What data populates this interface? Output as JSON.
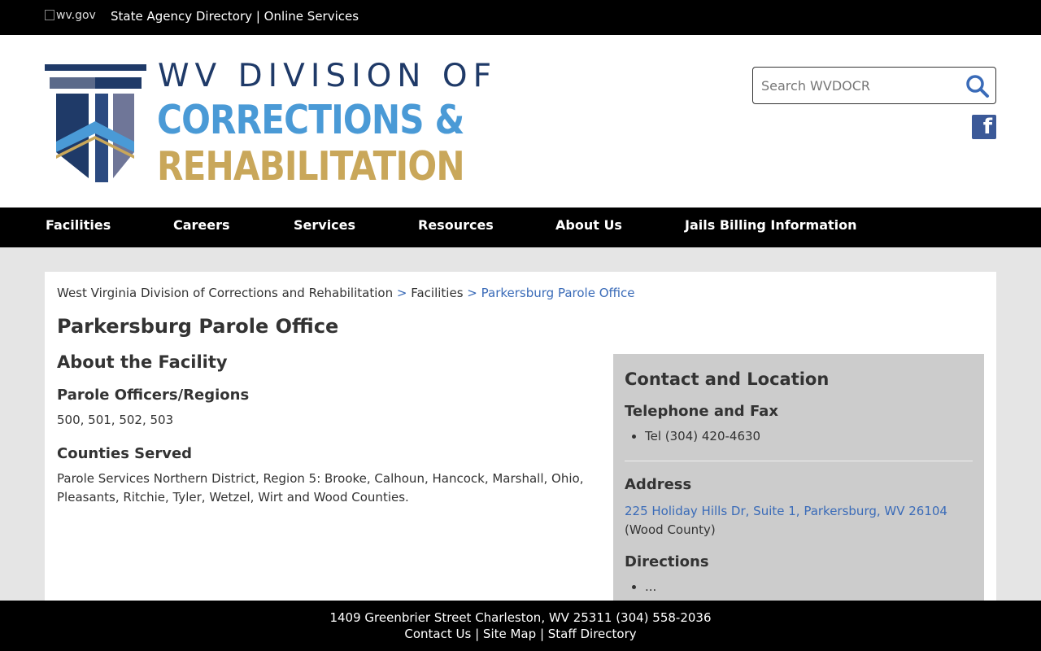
{
  "topbar": {
    "wv_logo_alt": "wv.gov",
    "state_agency_directory": "State Agency Directory",
    "divider": "|",
    "online_services": "Online Services"
  },
  "header": {
    "logo_line1": "WV DIVISION OF",
    "logo_line2": "CORRECTIONS &",
    "logo_line3": "REHABILITATION",
    "search_placeholder": "Search WVDOCR",
    "facebook_icon": "facebook-icon"
  },
  "nav": {
    "items": [
      {
        "label": "Facilities"
      },
      {
        "label": "Careers"
      },
      {
        "label": "Services"
      },
      {
        "label": "Resources"
      },
      {
        "label": "About Us"
      },
      {
        "label": "Jails Billing Information"
      }
    ]
  },
  "breadcrumb": {
    "root": "West Virginia Division of Corrections and Rehabilitation",
    "sep": ">",
    "level1": "Facilities",
    "current": "Parkersburg Parole Office"
  },
  "page": {
    "title": "Parkersburg Parole Office",
    "about_heading": "About the Facility",
    "officers_heading": "Parole Officers/Regions",
    "officers_value": "500, 501, 502, 503",
    "counties_heading": "Counties Served",
    "counties_line1": "Parole Services Northern District, Region 5: Brooke, Calhoun, Hancock, Marshall, Ohio,",
    "counties_line2": "Pleasants, Ritchie, Tyler, Wetzel, Wirt and Wood Counties."
  },
  "sidebar": {
    "heading": "Contact and Location",
    "phone_heading": "Telephone and Fax",
    "phone": "Tel (304) 420-4630",
    "address_heading": "Address",
    "address_link": "225 Holiday Hills Dr, Suite 1, Parkersburg, WV 26104",
    "county": "(Wood County)",
    "directions_heading": "Directions",
    "directions_item": "..."
  },
  "footer": {
    "address": "1409 Greenbrier Street Charleston, WV 25311 (304) 558-2036",
    "contact": "Contact Us",
    "divider": "|",
    "sitemap": "Site Map",
    "staff": "Staff Directory"
  },
  "colors": {
    "nav_bg": "#000000",
    "link_blue": "#3a6bb8",
    "logo_navy": "#1f3a68",
    "logo_blue": "#4a9ad6",
    "logo_gold": "#c9a75a",
    "sidebar_bg": "#cccccc"
  }
}
